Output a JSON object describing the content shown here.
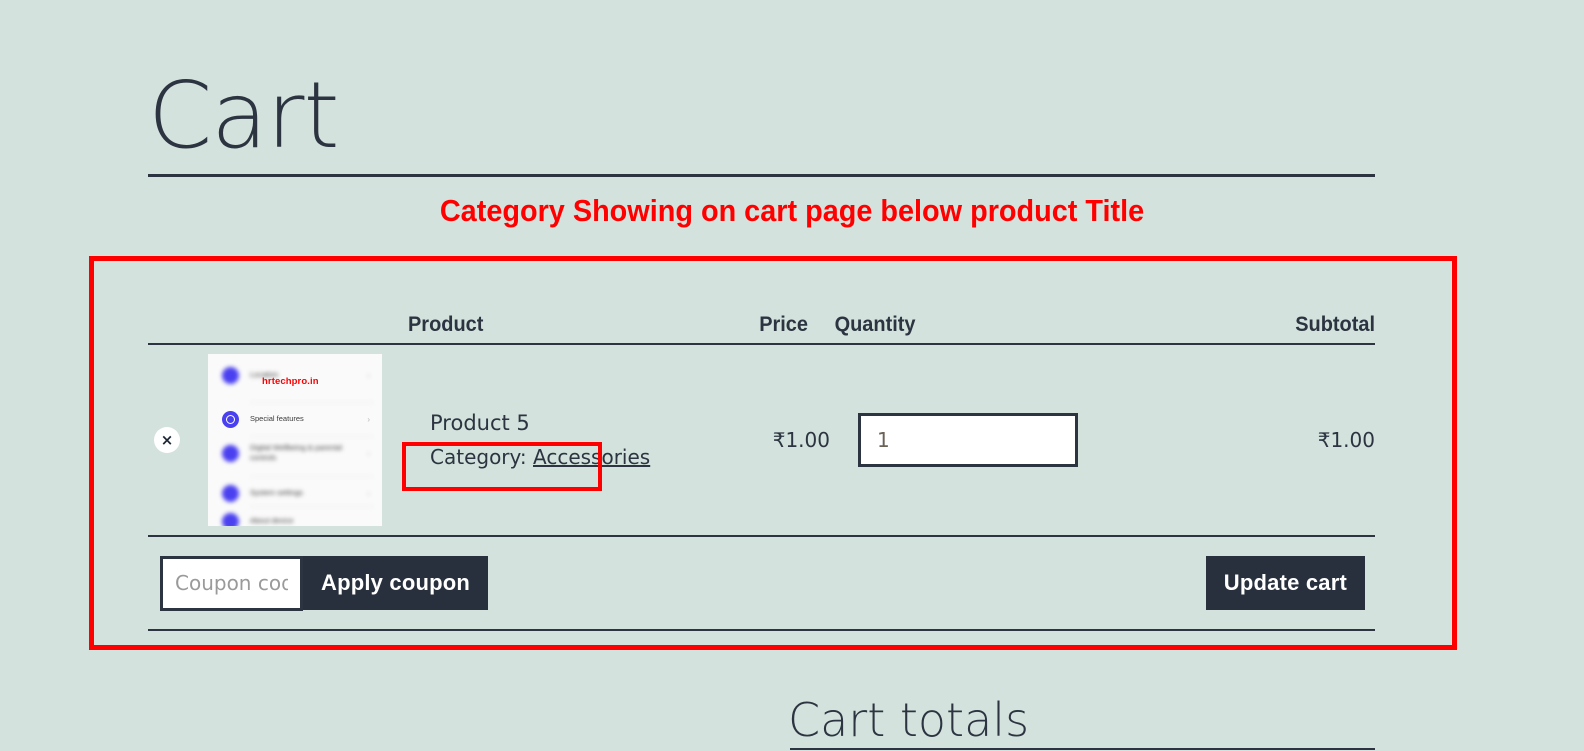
{
  "page": {
    "title": "Cart",
    "totals_heading": "Cart totals"
  },
  "annotations": {
    "caption": "Category Showing on cart page below product Title",
    "color": "#ff0000"
  },
  "cart": {
    "columns": {
      "product": "Product",
      "price": "Price",
      "quantity": "Quantity",
      "subtotal": "Subtotal"
    },
    "remove_label": "×",
    "item": {
      "name": "Product 5",
      "category_label": "Category:",
      "category_value": "Accessories",
      "price": "₹1.00",
      "quantity": "1",
      "subtotal": "₹1.00",
      "thumbnail": {
        "watermark": "hrtechpro.in",
        "rows": [
          "Location",
          "Special features",
          "Digital Wellbeing & parental controls",
          "System settings",
          "About device"
        ],
        "chevron": "›"
      }
    },
    "coupon": {
      "placeholder": "Coupon code",
      "value": "",
      "apply_label": "Apply coupon"
    },
    "update_label": "Update cart"
  },
  "colors": {
    "background": "#d3e2dc",
    "text": "#2b3440",
    "button": "#28303d",
    "accent_red": "#ff0000",
    "icon_blue": "#4a40f0"
  }
}
